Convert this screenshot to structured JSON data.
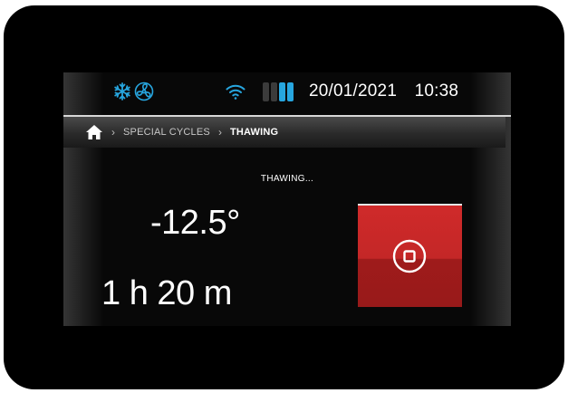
{
  "status": {
    "icons": [
      "snowflake-icon",
      "fan-icon",
      "wifi-icon"
    ],
    "battery_total_cells": 4,
    "battery_active_cells": 2,
    "date": "20/01/2021",
    "time": "10:38"
  },
  "breadcrumb": {
    "home_icon": "home-icon",
    "items": [
      "SPECIAL CYCLES",
      "THAWING"
    ]
  },
  "main": {
    "status_text": "THAWING...",
    "temperature": "-12.5°",
    "remaining_time": "1 h 20 m",
    "stop_button_icon": "stop-icon"
  },
  "colors": {
    "accent": "#27a6df",
    "stop_button": "#c42727",
    "background": "#080808"
  }
}
